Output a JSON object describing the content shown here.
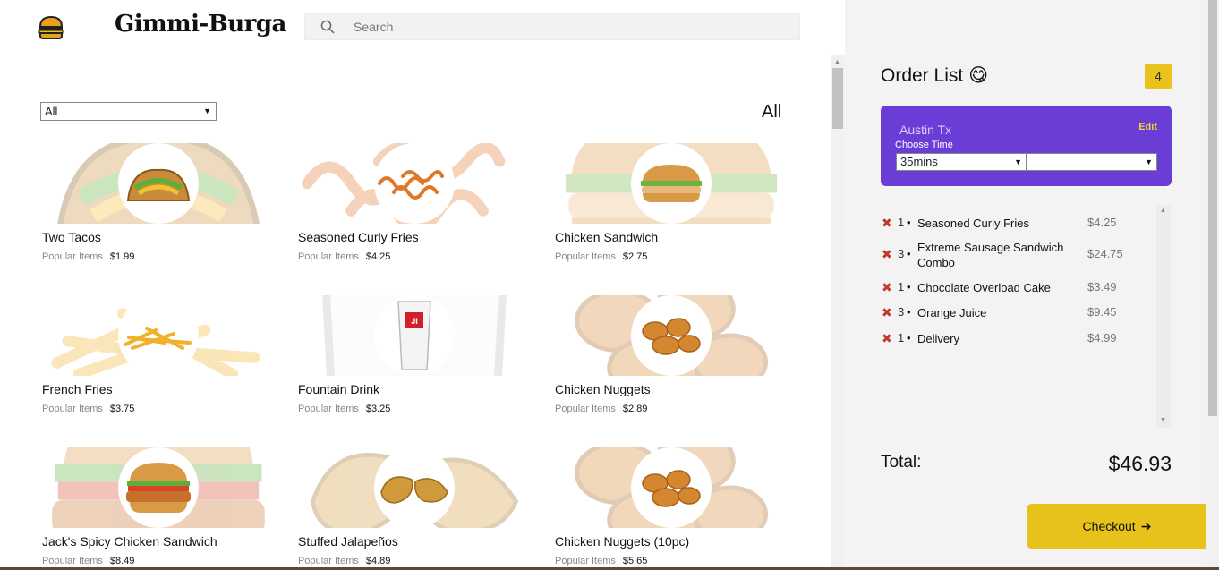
{
  "app": {
    "brand": "Gimmi-Burga"
  },
  "search": {
    "placeholder": "Search"
  },
  "filter": {
    "selected": "All",
    "heading": "All"
  },
  "menu": {
    "items": [
      {
        "name": "Two Tacos",
        "category": "Popular Items",
        "price": "$1.99",
        "icon": "taco-icon"
      },
      {
        "name": "Seasoned Curly Fries",
        "category": "Popular Items",
        "price": "$4.25",
        "icon": "curly-fries-icon"
      },
      {
        "name": "Chicken Sandwich",
        "category": "Popular Items",
        "price": "$2.75",
        "icon": "sandwich-icon"
      },
      {
        "name": "French Fries",
        "category": "Popular Items",
        "price": "$3.75",
        "icon": "fries-icon"
      },
      {
        "name": "Fountain Drink",
        "category": "Popular Items",
        "price": "$3.25",
        "icon": "drink-cup-icon"
      },
      {
        "name": "Chicken Nuggets",
        "category": "Popular Items",
        "price": "$2.89",
        "icon": "nuggets-icon"
      },
      {
        "name": "Jack's Spicy Chicken Sandwich",
        "category": "Popular Items",
        "price": "$8.49",
        "icon": "spicy-sandwich-icon"
      },
      {
        "name": "Stuffed Jalapeños",
        "category": "Popular Items",
        "price": "$4.89",
        "icon": "jalapenos-icon"
      },
      {
        "name": "Chicken Nuggets (10pc)",
        "category": "Popular Items",
        "price": "$5.65",
        "icon": "nuggets-icon"
      }
    ]
  },
  "order": {
    "title": "Order List",
    "emoji": "😋",
    "count": "4",
    "location": "Austin Tx",
    "edit_label": "Edit",
    "choose_time_label": "Choose Time",
    "time_value": "35mins",
    "time_value2": "",
    "items": [
      {
        "qty": "1",
        "name": "Seasoned Curly Fries",
        "price": "$4.25"
      },
      {
        "qty": "3",
        "name": "Extreme Sausage Sandwich Combo",
        "price": "$24.75"
      },
      {
        "qty": "1",
        "name": "Chocolate Overload Cake",
        "price": "$3.49"
      },
      {
        "qty": "3",
        "name": "Orange Juice",
        "price": "$9.45"
      },
      {
        "qty": "1",
        "name": "Delivery",
        "price": "$4.99"
      }
    ],
    "total_label": "Total:",
    "total_value": "$46.93",
    "checkout_label": "Checkout",
    "checkout_arrow": "➔"
  },
  "colors": {
    "accent_yellow": "#e6c21a",
    "location_purple": "#6a3ed6",
    "remove_red": "#c0392b"
  }
}
